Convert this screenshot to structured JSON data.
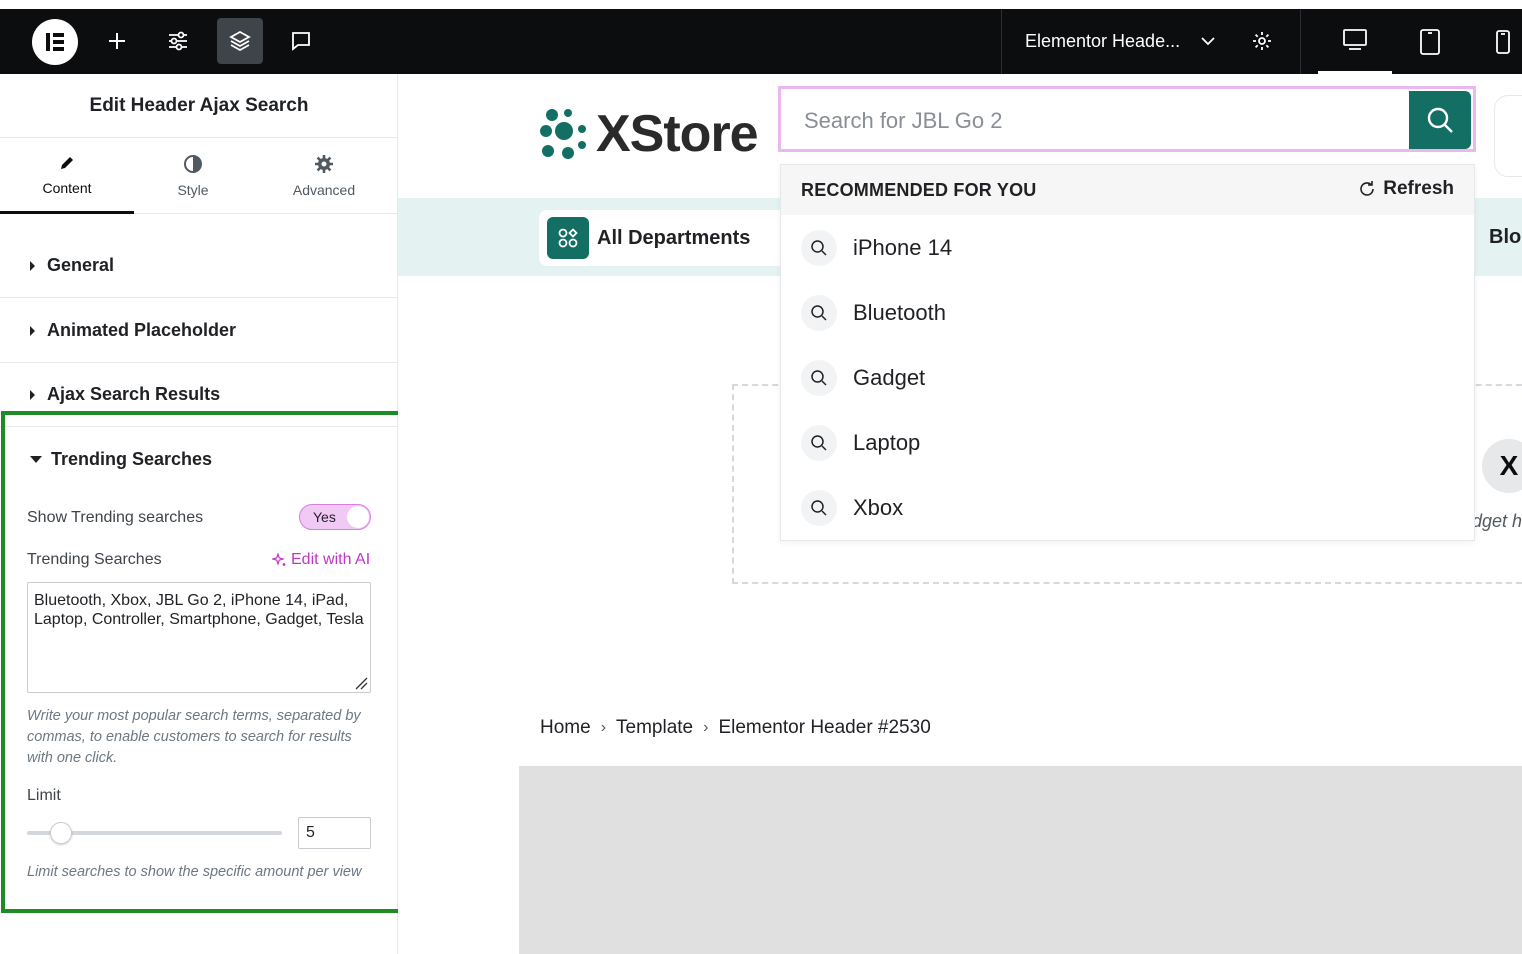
{
  "topbar": {
    "document_title": "Elementor Heade...",
    "icons": [
      "elementor-logo-icon",
      "add-icon",
      "settings-sliders-icon",
      "layers-icon",
      "comment-icon",
      "chevron-down-icon",
      "gear-icon",
      "desktop-icon",
      "tablet-icon",
      "mobile-icon"
    ]
  },
  "panel": {
    "title": "Edit Header Ajax Search",
    "tabs": [
      {
        "label": "Content",
        "icon": "pencil-icon"
      },
      {
        "label": "Style",
        "icon": "half-circle-icon"
      },
      {
        "label": "Advanced",
        "icon": "cog-icon"
      }
    ],
    "sections": [
      {
        "label": "General"
      },
      {
        "label": "Animated Placeholder"
      },
      {
        "label": "Ajax Search Results"
      },
      {
        "label": "Trending Searches"
      }
    ],
    "trending": {
      "show_label": "Show Trending searches",
      "toggle_value": "Yes",
      "searches_label": "Trending Searches",
      "edit_ai_label": "Edit with AI",
      "searches_value_line1": "Bluetooth,  Xbox,  JBL Go 2, iPhone 14, iPad,",
      "searches_value_line2": "Laptop, Controller, Smartphone, Gadget, Tesla",
      "help_line1": "Write your most popular search terms, separated by",
      "help_line2": "commas, to enable customers to search for results",
      "help_line3": "with one click.",
      "limit_label": "Limit",
      "limit_value": "5",
      "limit_fraction": 0.12,
      "limit_help": "Limit searches to show the specific amount per view"
    }
  },
  "preview": {
    "brand": "XStore",
    "search_placeholder": "Search for JBL Go 2",
    "dropdown": {
      "title": "RECOMMENDED FOR YOU",
      "refresh_label": "Refresh",
      "items": [
        "iPhone 14",
        "Bluetooth",
        "Gadget",
        "Laptop",
        "Xbox"
      ]
    },
    "departments_label": "All Departments",
    "blog_label": "Blog",
    "x_label": "X",
    "widget_hint": "dget he",
    "breadcrumb": [
      "Home",
      "Template",
      "Elementor Header #2530"
    ],
    "colors": {
      "accent": "#136f63",
      "highlight": "#1f8b24",
      "ai": "#c036c8"
    }
  }
}
